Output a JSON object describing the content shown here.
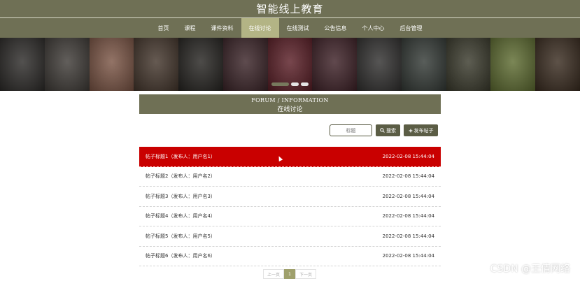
{
  "site": {
    "title": "智能线上教育"
  },
  "nav": {
    "items": [
      {
        "label": "首页"
      },
      {
        "label": "课程"
      },
      {
        "label": "课件资料"
      },
      {
        "label": "在线讨论"
      },
      {
        "label": "在线测试"
      },
      {
        "label": "公告信息"
      },
      {
        "label": "个人中心"
      },
      {
        "label": "后台管理"
      }
    ],
    "active": "在线讨论"
  },
  "banner": {
    "slide_count": 3,
    "active_slide": 1,
    "colors": [
      "#2d2b29",
      "#3f3b37",
      "#7b5545",
      "#44362c",
      "#262421",
      "#3b2428",
      "#5a1e26",
      "#3e2127",
      "#31302f",
      "#343a36",
      "#3a3a2c",
      "#5e6c31",
      "#3a2c20"
    ]
  },
  "section": {
    "title_en": "FORUM / INFORMATION",
    "title_cn": "在线讨论"
  },
  "search": {
    "placeholder": "标题",
    "search_label": "搜索",
    "search_icon": "search-icon",
    "post_label": "发布帖子",
    "post_icon": "plus-icon"
  },
  "posts": [
    {
      "title": "帖子标题1（发布人：用户名1）",
      "date": "2022-02-08 15:44:04"
    },
    {
      "title": "帖子标题2（发布人：用户名2）",
      "date": "2022-02-08 15:44:04"
    },
    {
      "title": "帖子标题3（发布人：用户名3）",
      "date": "2022-02-08 15:44:04"
    },
    {
      "title": "帖子标题4（发布人：用户名4）",
      "date": "2022-02-08 15:44:04"
    },
    {
      "title": "帖子标题5（发布人：用户名5）",
      "date": "2022-02-08 15:44:04"
    },
    {
      "title": "帖子标题6（发布人：用户名6）",
      "date": "2022-02-08 15:44:04"
    }
  ],
  "pagination": {
    "prev": "上一页",
    "current": "1",
    "next": "下一页"
  },
  "watermark": "CSDN @王倩网络",
  "colors": {
    "brand": "#6f7055",
    "active_nav": "#b3b485",
    "highlight": "#c90000",
    "page_active": "#9fa06c"
  }
}
